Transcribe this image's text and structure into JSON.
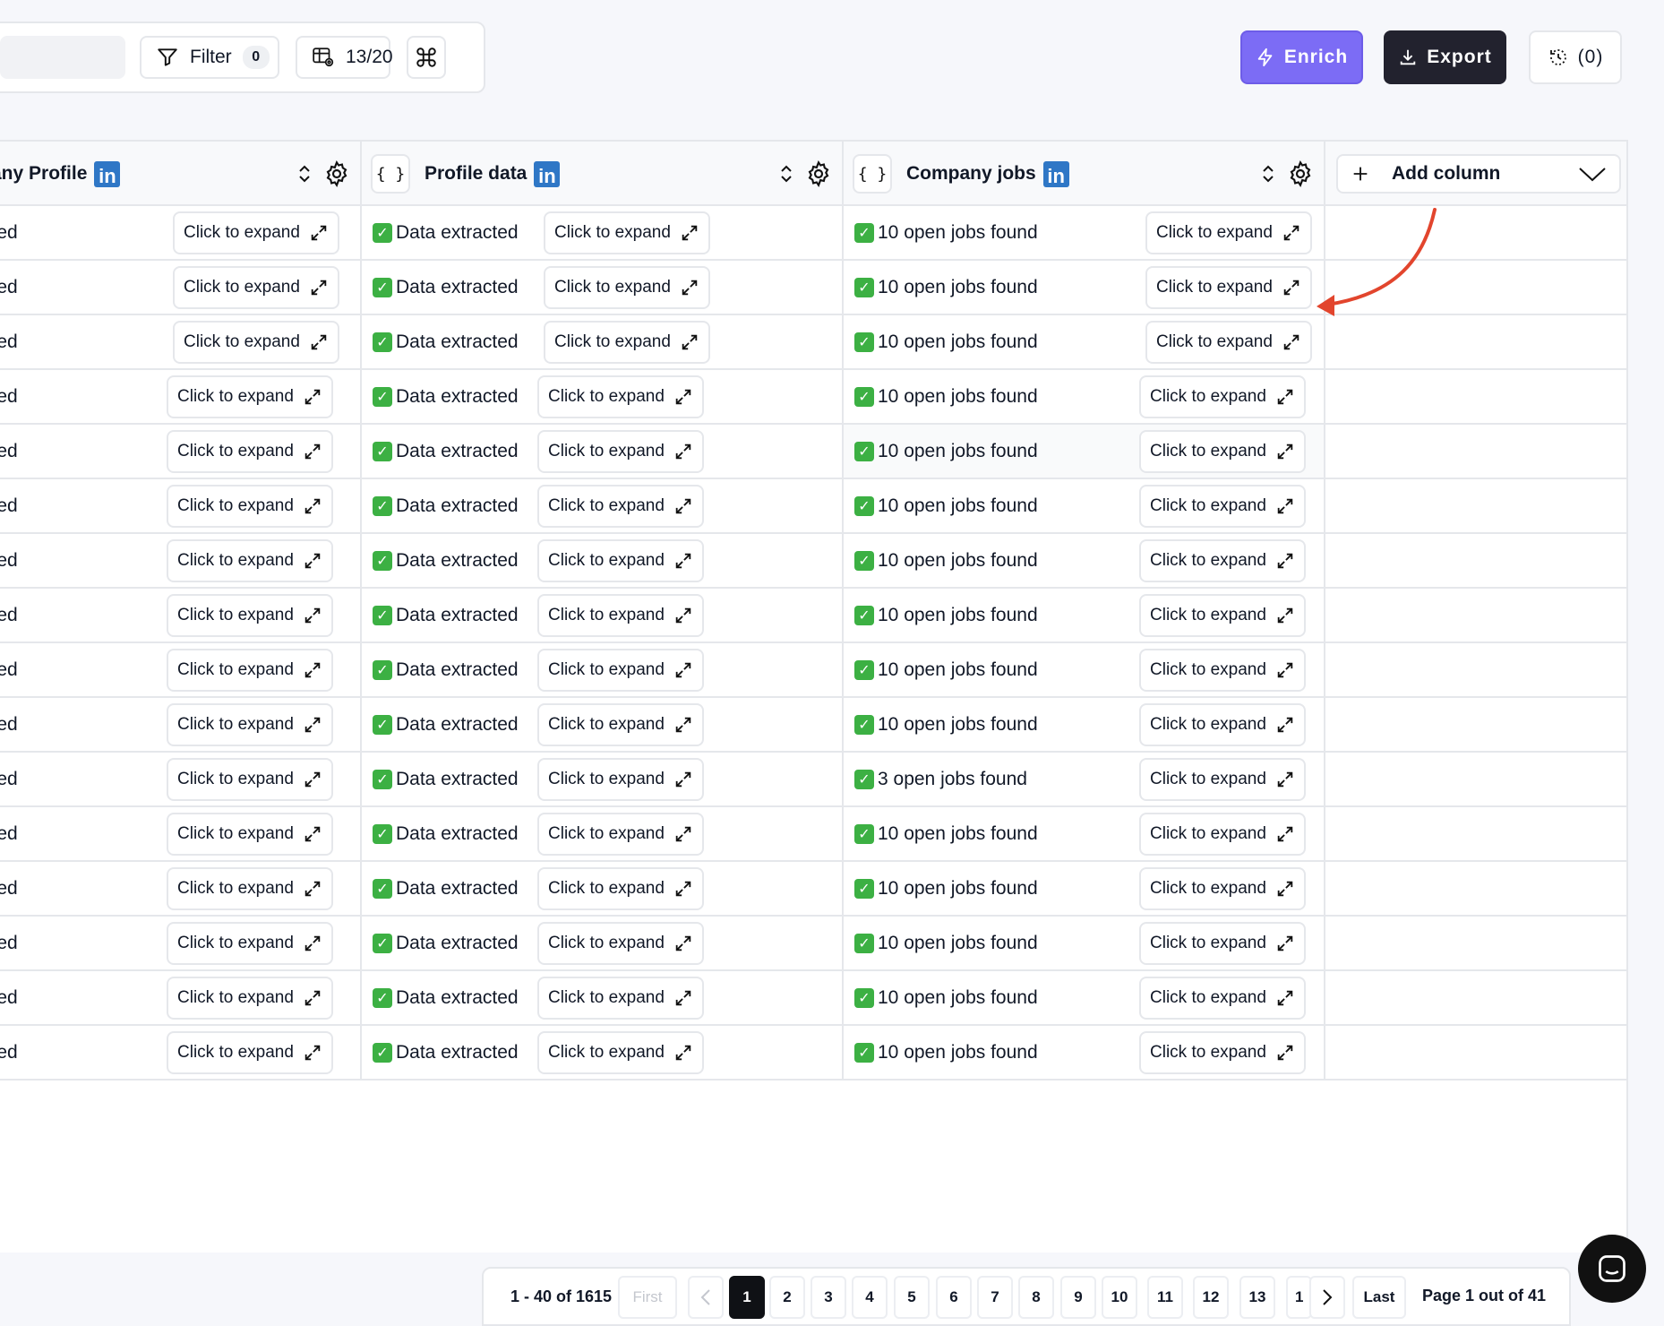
{
  "toolbar": {
    "filter_label": "Filter",
    "filter_count": "0",
    "columns_label": "13/20",
    "enrich_label": "Enrich",
    "export_label": "Export",
    "history_label": "(0)"
  },
  "columns": [
    {
      "title": "any Profile",
      "type_chip": ""
    },
    {
      "title": "Profile data",
      "type_chip": "{ }"
    },
    {
      "title": "Company jobs",
      "type_chip": "{ }"
    }
  ],
  "add_column_label": "Add column",
  "expand_label": "Click to expand",
  "rows": [
    {
      "c1": "cted",
      "c2": "Data extracted",
      "c3": "10 open jobs found"
    },
    {
      "c1": "cted",
      "c2": "Data extracted",
      "c3": "10 open jobs found"
    },
    {
      "c1": "cted",
      "c2": "Data extracted",
      "c3": "10 open jobs found"
    },
    {
      "c1": "cted",
      "c2": "Data extracted",
      "c3": "10 open jobs found"
    },
    {
      "c1": "cted",
      "c2": "Data extracted",
      "c3": "10 open jobs found"
    },
    {
      "c1": "cted",
      "c2": "Data extracted",
      "c3": "10 open jobs found"
    },
    {
      "c1": "cted",
      "c2": "Data extracted",
      "c3": "10 open jobs found"
    },
    {
      "c1": "cted",
      "c2": "Data extracted",
      "c3": "10 open jobs found"
    },
    {
      "c1": "cted",
      "c2": "Data extracted",
      "c3": "10 open jobs found"
    },
    {
      "c1": "cted",
      "c2": "Data extracted",
      "c3": "10 open jobs found"
    },
    {
      "c1": "cted",
      "c2": "Data extracted",
      "c3": "3 open jobs found"
    },
    {
      "c1": "cted",
      "c2": "Data extracted",
      "c3": "10 open jobs found"
    },
    {
      "c1": "cted",
      "c2": "Data extracted",
      "c3": "10 open jobs found"
    },
    {
      "c1": "cted",
      "c2": "Data extracted",
      "c3": "10 open jobs found"
    },
    {
      "c1": "cted",
      "c2": "Data extracted",
      "c3": "10 open jobs found"
    },
    {
      "c1": "cted",
      "c2": "Data extracted",
      "c3": "10 open jobs found"
    }
  ],
  "pagination": {
    "range": "1 - 40 of 1615",
    "first": "First",
    "pages": [
      "1",
      "2",
      "3",
      "4",
      "5",
      "6",
      "7",
      "8",
      "9",
      "10",
      "11",
      "12",
      "13",
      "1"
    ],
    "current": "1",
    "last": "Last",
    "page_info": "Page 1 out of 41"
  },
  "colors": {
    "enrich": "#7c6cf5",
    "export": "#22222e",
    "linkedin": "#2f77c6",
    "check": "#3cb043",
    "annotation_arrow": "#e2452d"
  }
}
